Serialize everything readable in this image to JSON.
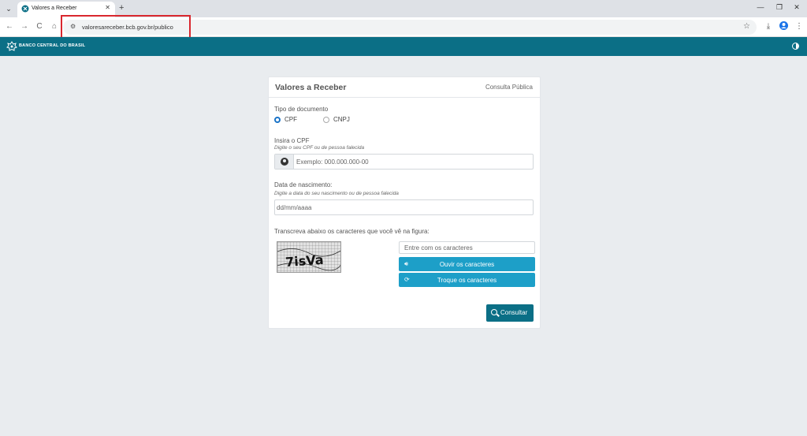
{
  "browser": {
    "tab_title": "Valores a Receber",
    "tab_close": "✕",
    "new_tab": "+",
    "url": "valoresareceber.bcb.gov.br/publico",
    "window_controls": {
      "minimize": "—",
      "restore": "❐",
      "close": "✕"
    },
    "nav": {
      "back": "←",
      "forward": "→",
      "reload": "C",
      "home": "⌂"
    },
    "bookmark_star": "☆",
    "menu_dots": "⋮",
    "download_icon": "⤓"
  },
  "site_header": {
    "logo_text": "BANCO CENTRAL DO BRASIL",
    "accent_color": "#0b6f86"
  },
  "card": {
    "title": "Valores a Receber",
    "subtitle": "Consulta Pública",
    "document_type": {
      "label": "Tipo de documento",
      "options": [
        {
          "label": "CPF",
          "checked": true
        },
        {
          "label": "CNPJ",
          "checked": false
        }
      ]
    },
    "cpf": {
      "label": "Insira o CPF",
      "hint": "Digite o seu CPF ou de pessoa falecida",
      "placeholder": "Exemplo: 000.000.000-00"
    },
    "birth_date": {
      "label": "Data de nascimento:",
      "hint": "Digite a data do seu nascimento ou de pessoa falecida",
      "placeholder": "dd/mm/aaaa"
    },
    "captcha": {
      "label": "Transcreva abaixo os caracteres que você vê na figura:",
      "image_text": "7isVa",
      "input_placeholder": "Entre com os caracteres",
      "listen_button": "Ouvir os caracteres",
      "refresh_button": "Troque os caracteres",
      "button_color": "#1d9fc8"
    },
    "submit_button": "Consultar"
  }
}
